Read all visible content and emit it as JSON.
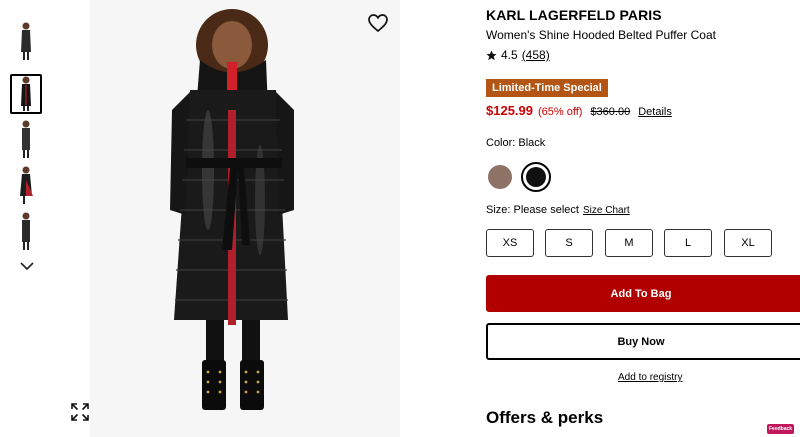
{
  "product": {
    "brand": "KARL LAGERFELD PARIS",
    "title": "Women's Shine Hooded Belted Puffer Coat",
    "rating": "4.5",
    "review_count": "(458)",
    "badge": "Limited-Time Special",
    "sale_price": "$125.99",
    "discount": "(65% off)",
    "original_price": "$360.00",
    "details_link": "Details"
  },
  "color": {
    "label": "Color: Black",
    "swatches": [
      {
        "name": "Brown",
        "hex": "#8f7266",
        "selected": false
      },
      {
        "name": "Black",
        "hex": "#111111",
        "selected": true
      }
    ]
  },
  "size": {
    "label": "Size: Please select",
    "chart_link": "Size Chart",
    "options": [
      "XS",
      "S",
      "M",
      "L",
      "XL"
    ]
  },
  "actions": {
    "add_to_bag": "Add To Bag",
    "buy_now": "Buy Now",
    "registry": "Add to registry"
  },
  "offers_heading": "Offers & perks",
  "feedback_label": "Feedback",
  "colors": {
    "sale_red": "#cc0000",
    "add_bag_red": "#b10000",
    "badge_orange": "#b35514"
  },
  "icons": {
    "wishlist": "heart-outline-icon",
    "expand": "expand-arrows-icon",
    "thumb_more": "chevron-down-icon",
    "rating": "star-icon"
  }
}
